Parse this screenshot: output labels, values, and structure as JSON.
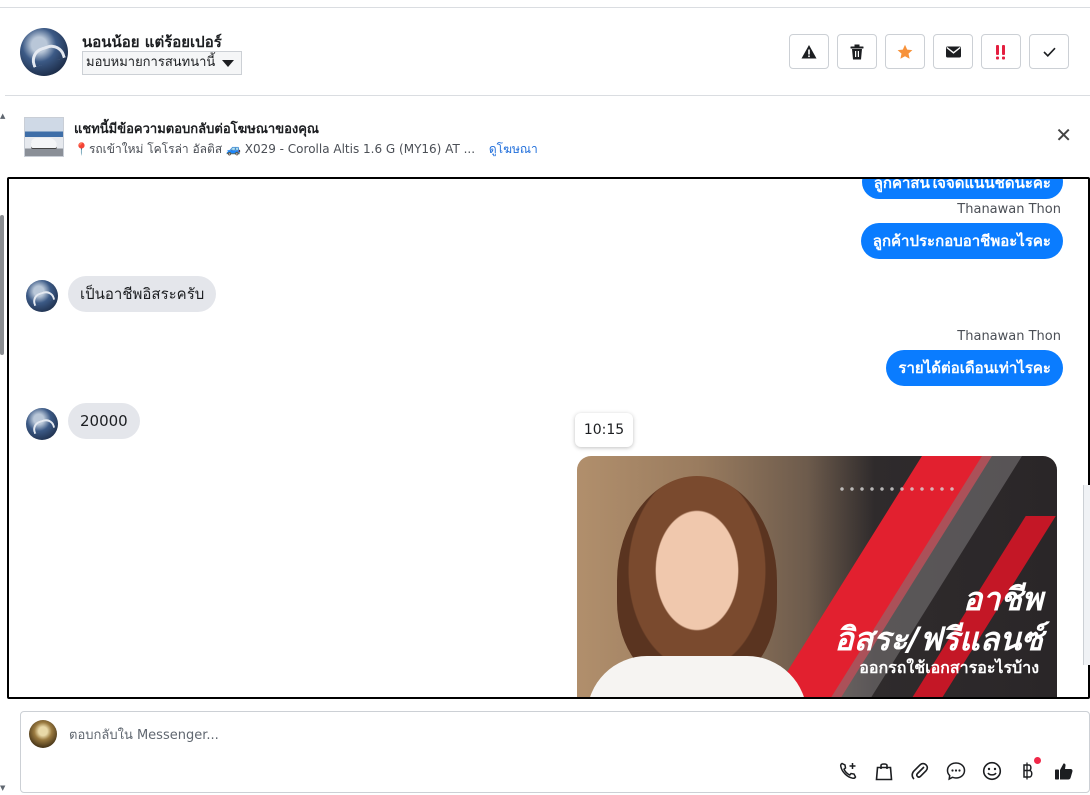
{
  "header": {
    "contact_name": "นอนน้อย แต่ร้อยเปอร์",
    "assign_label": "มอบหมายการสนทนานี้",
    "actions": [
      {
        "name": "spam-button",
        "icon": "warning-icon"
      },
      {
        "name": "delete-button",
        "icon": "trash-icon"
      },
      {
        "name": "star-button",
        "icon": "star-icon"
      },
      {
        "name": "mark-unread-button",
        "icon": "envelope-icon"
      },
      {
        "name": "follow-up-button",
        "icon": "exclamation-icon"
      },
      {
        "name": "done-button",
        "icon": "check-icon"
      }
    ],
    "star_color": "#f7923a",
    "follow_up_color": "#e41e3f"
  },
  "ad_banner": {
    "title": "แชทนี้มีข้อความตอบกลับต่อโฆษณาของคุณ",
    "subtitle": "รถเข้าใหม่ โคโรล่า อัลติส 🚙 X029 - Corolla Altis 1.6 G (MY16) AT ...",
    "link": "ดูโฆษณา",
    "close_icon": "close-icon"
  },
  "messages": {
    "out_partial": "ลูกค้าสนใจจัดแน่นชัดนะคะ",
    "sender_1": "Thanawan Thon",
    "out_1": "ลูกค้าประกอบอาชีพอะไรคะ",
    "in_1": "เป็นอาชีพอิสระครับ",
    "sender_2": "Thanawan Thon",
    "out_2": "รายได้ต่อเดือนเท่าไรคะ",
    "in_2": "20000",
    "tooltip_time": "10:15",
    "promo_line_1": "อาชีพ",
    "promo_line_2": "อิสระ/ฟรีแลนซ์",
    "promo_line_3": "ออกรถใช้เอกสารอะไรบ้าง"
  },
  "composer": {
    "placeholder": "ตอบกลับใน Messenger...",
    "tools": [
      "phone-plus-icon",
      "shopping-bag-icon",
      "paperclip-icon",
      "chat-bubble-icon",
      "emoji-icon",
      "baht-icon",
      "thumbs-up-icon"
    ],
    "accent_color": "#1c1e21"
  },
  "colors": {
    "outgoing_bubble": "#0a7cff",
    "incoming_bubble": "#e4e6eb",
    "link": "#216fdb"
  }
}
